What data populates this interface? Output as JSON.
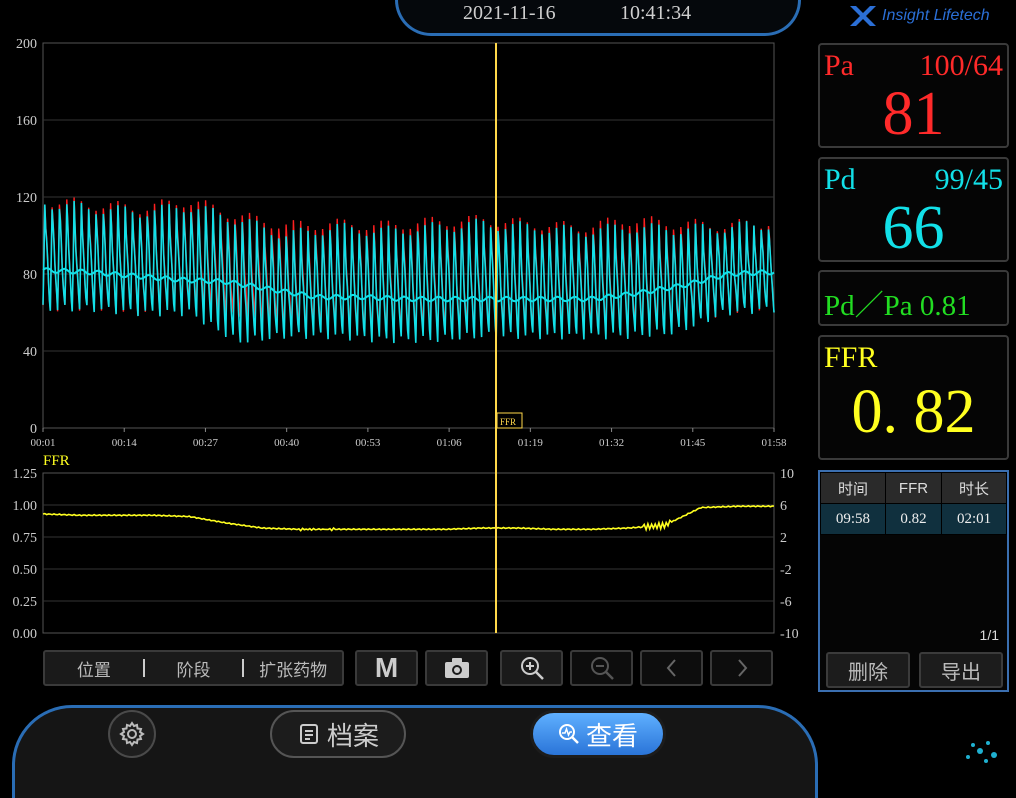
{
  "header": {
    "date": "2021-11-16",
    "time": "10:41:34",
    "brand": "Insight Lifetech"
  },
  "top_chart": {
    "y_ticks": [
      "200",
      "160",
      "120",
      "80",
      "40",
      "0"
    ],
    "x_ticks": [
      "00:01",
      "00:14",
      "00:27",
      "00:40",
      "00:53",
      "01:06",
      "01:19",
      "01:32",
      "01:45",
      "01:58"
    ],
    "cursor_label": "FFR"
  },
  "ffr_chart": {
    "title": "FFR",
    "y_left": [
      "1.25",
      "1.00",
      "0.75",
      "0.50",
      "0.25",
      "0.00"
    ],
    "y_right": [
      "10",
      "6",
      "2",
      "-2",
      "-6",
      "-10"
    ]
  },
  "chart_data": [
    {
      "type": "line",
      "title": "",
      "xlabel": "",
      "ylabel": "",
      "ylim": [
        0,
        200
      ],
      "x_range": [
        "00:01",
        "01:58"
      ],
      "series": [
        {
          "name": "Pa",
          "color": "#ff2020",
          "sys": [
            118,
            116,
            114,
            118,
            110,
            105,
            106,
            105,
            107,
            108,
            106,
            104,
            108,
            106,
            105,
            107
          ],
          "dia": [
            62,
            62,
            60,
            62,
            58,
            52,
            50,
            48,
            49,
            50,
            50,
            51,
            50,
            52,
            60,
            62
          ],
          "note_points": [
            [
              0.0,
              118
            ],
            [
              0.5,
              105
            ],
            [
              1.0,
              107
            ]
          ]
        },
        {
          "name": "Pd",
          "color": "#12e0e8",
          "sys": [
            117,
            114,
            112,
            115,
            108,
            100,
            104,
            102,
            104,
            106,
            104,
            102,
            104,
            103,
            104,
            106
          ],
          "dia": [
            62,
            62,
            60,
            60,
            45,
            48,
            48,
            46,
            46,
            48,
            48,
            48,
            48,
            50,
            60,
            62
          ]
        },
        {
          "name": "Pd mean",
          "color": "#12e0e8",
          "values": [
            82,
            81,
            79,
            77,
            76,
            72,
            68,
            68,
            67,
            67,
            67,
            67,
            67,
            70,
            74,
            80,
            81
          ]
        }
      ],
      "cursor_x": "01:17"
    },
    {
      "type": "line",
      "title": "FFR",
      "ylim": [
        0,
        1.25
      ],
      "series": [
        {
          "name": "FFR",
          "color": "#ffff20",
          "values": [
            0.93,
            0.92,
            0.92,
            0.92,
            0.91,
            0.86,
            0.82,
            0.81,
            0.81,
            0.81,
            0.81,
            0.81,
            0.82,
            0.82,
            0.81,
            0.81,
            0.82,
            0.84,
            0.98,
            0.99,
            0.99
          ]
        }
      ]
    }
  ],
  "panels": {
    "pa": {
      "label": "Pa",
      "range": "100/64",
      "value": "81"
    },
    "pd": {
      "label": "Pd",
      "range": "99/45",
      "value": "66"
    },
    "ratio": {
      "text": "Pd／Pa 0.81"
    },
    "ffr": {
      "label": "FFR",
      "value": "0. 82"
    }
  },
  "table": {
    "headers": [
      "时间",
      "FFR",
      "时长"
    ],
    "rows": [
      [
        "09:58",
        "0.82",
        "02:01"
      ]
    ],
    "page": "1/1",
    "delete_label": "删除",
    "export_label": "导出"
  },
  "toolbar": {
    "seg1": "位置",
    "seg2": "阶段",
    "seg3": "扩张药物",
    "m_label": "M"
  },
  "bottom_nav": {
    "archive_label": "档案",
    "view_label": "查看"
  },
  "colors": {
    "pa": "#ff2a2a",
    "pd": "#12e0e8",
    "ratio": "#22dd22",
    "ffr": "#ffff20",
    "accent": "#2a6db5"
  }
}
